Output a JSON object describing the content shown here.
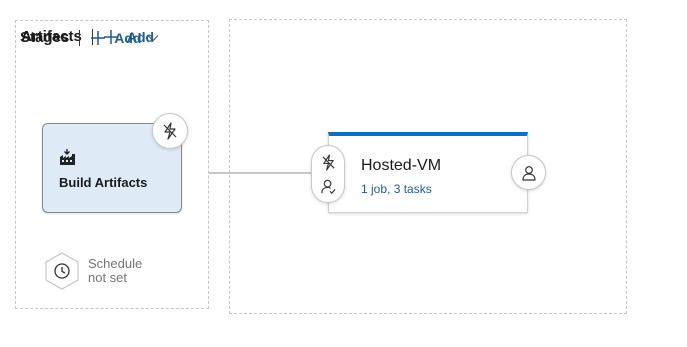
{
  "artifacts": {
    "title": "Artifacts",
    "add_label": "Add",
    "card": {
      "label": "Build Artifacts",
      "icon": "build-icon",
      "trigger_icon": "lightning-icon"
    },
    "schedule": {
      "line1": "Schedule",
      "line2": "not set",
      "icon": "clock-icon"
    }
  },
  "stages": {
    "title": "Stages",
    "add_label": "Add",
    "stage": {
      "name": "Hosted-VM",
      "summary": "1 job, 3 tasks",
      "pre_icons": [
        "lightning-icon",
        "approver-icon"
      ],
      "post_icon": "person-icon"
    }
  },
  "colors": {
    "accent": "#106ebe",
    "link": "#1f5f96",
    "artifact_bg": "#deebf7",
    "border": "#c8c8c8"
  }
}
